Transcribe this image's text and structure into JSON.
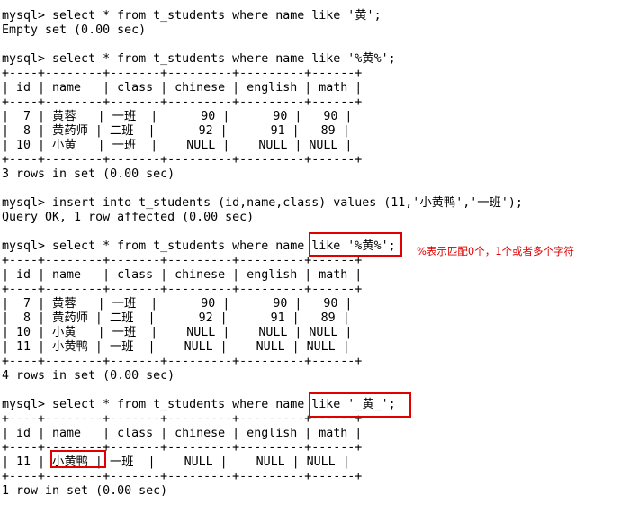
{
  "terminal": {
    "lines": [
      "mysql> select * from t_students where name like '黄';",
      "Empty set (0.00 sec)",
      "",
      "mysql> select * from t_students where name like '%黄%';",
      "+----+--------+-------+---------+---------+------+",
      "| id | name   | class | chinese | english | math |",
      "+----+--------+-------+---------+---------+------+",
      "|  7 | 黄蓉   | 一班  |      90 |      90 |   90 |",
      "|  8 | 黄药师 | 二班  |      92 |      91 |   89 |",
      "| 10 | 小黄   | 一班  |    NULL |    NULL | NULL |",
      "+----+--------+-------+---------+---------+------+",
      "3 rows in set (0.00 sec)",
      "",
      "mysql> insert into t_students (id,name,class) values (11,'小黄鸭','一班');",
      "Query OK, 1 row affected (0.00 sec)",
      "",
      "mysql> select * from t_students where name like '%黄%';",
      "+----+--------+-------+---------+---------+------+",
      "| id | name   | class | chinese | english | math |",
      "+----+--------+-------+---------+---------+------+",
      "|  7 | 黄蓉   | 一班  |      90 |      90 |   90 |",
      "|  8 | 黄药师 | 二班  |      92 |      91 |   89 |",
      "| 10 | 小黄   | 一班  |    NULL |    NULL | NULL |",
      "| 11 | 小黄鸭 | 一班  |    NULL |    NULL | NULL |",
      "+----+--------+-------+---------+---------+------+",
      "4 rows in set (0.00 sec)",
      "",
      "mysql> select * from t_students where name like '_黄_';",
      "+----+--------+-------+---------+---------+------+",
      "| id | name   | class | chinese | english | math |",
      "+----+--------+-------+---------+---------+------+",
      "| 11 | 小黄鸭 | 一班  |    NULL |    NULL | NULL |",
      "+----+--------+-------+---------+---------+------+",
      "1 row in set (0.00 sec)"
    ]
  },
  "annotation": {
    "note": "%表示匹配0个，1个或者多个字符",
    "color": "#e00000"
  },
  "colors": {
    "background": "#ffffff",
    "text": "#000000",
    "highlight": "#e00000"
  }
}
